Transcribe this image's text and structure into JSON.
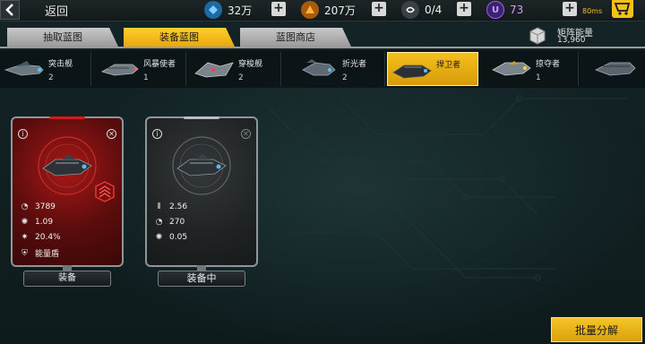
{
  "header": {
    "back_label": "返回",
    "resources": [
      {
        "icon": "blue-crystal-icon",
        "value": "32万",
        "color": "#3aa7e8"
      },
      {
        "icon": "gold-triangle-icon",
        "value": "207万",
        "color": "#e8911a"
      },
      {
        "icon": "stamina-icon",
        "value": "0/4",
        "color": "#d8d8d8"
      },
      {
        "icon": "purple-u-icon",
        "value": "73",
        "color": "#9a5ff0"
      }
    ],
    "ping": "80ms"
  },
  "tabs": [
    {
      "label": "抽取蓝图",
      "active": false
    },
    {
      "label": "装备蓝图",
      "active": true
    },
    {
      "label": "蓝图商店",
      "active": false
    }
  ],
  "matrix_energy": {
    "label": "矩阵能量",
    "value": "13,960"
  },
  "ships": [
    {
      "name": "突击舰",
      "count": "2",
      "active": false
    },
    {
      "name": "风暴使者",
      "count": "1",
      "active": false
    },
    {
      "name": "穿梭舰",
      "count": "2",
      "active": false
    },
    {
      "name": "折光者",
      "count": "2",
      "active": false
    },
    {
      "name": "捍卫者",
      "count": "",
      "active": true
    },
    {
      "name": "掠夺者",
      "count": "1",
      "active": false
    }
  ],
  "cards": [
    {
      "style": "red",
      "stats": [
        {
          "icon": "armor-icon",
          "value": "3789"
        },
        {
          "icon": "gear-stat-icon",
          "value": "1.09"
        },
        {
          "icon": "burst-icon",
          "value": "20.4%"
        },
        {
          "icon": "shield-icon",
          "value": "能量盾"
        }
      ],
      "button": "装备"
    },
    {
      "style": "gray",
      "stats": [
        {
          "icon": "ammo-icon",
          "value": "2.56"
        },
        {
          "icon": "armor-icon",
          "value": "270"
        },
        {
          "icon": "gear-stat-icon",
          "value": "0.05"
        }
      ],
      "button": "装备中"
    }
  ],
  "bulk_button": "批量分解"
}
